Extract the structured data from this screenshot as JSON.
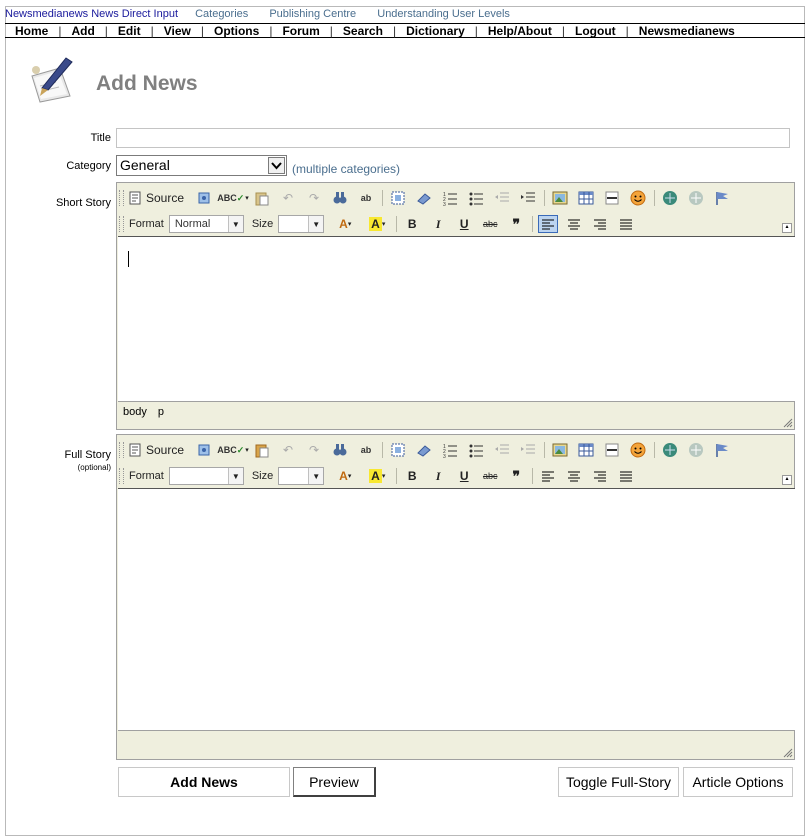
{
  "toplinks": {
    "site": "Newsmedianews News Direct Input",
    "categories": "Categories",
    "publishing": "Publishing Centre",
    "levels": "Understanding User Levels"
  },
  "menu": [
    "Home",
    "Add",
    "Edit",
    "View",
    "Options",
    "Forum",
    "Search",
    "Dictionary",
    "Help/About",
    "Logout",
    "Newsmedianews"
  ],
  "page": {
    "title": "Add News",
    "icon": "pen-paper-icon"
  },
  "form": {
    "title_label": "Title",
    "title_value": "",
    "category_label": "Category",
    "category_value": "General",
    "multiple_categories": "(multiple categories)",
    "short_story_label": "Short Story",
    "full_story_label": "Full Story",
    "full_story_optional": "(optional)"
  },
  "editor": {
    "source_label": "Source",
    "format_label": "Format",
    "format_value_short": "Normal",
    "format_value_full": "",
    "size_label": "Size",
    "size_value": "",
    "short_status_path": [
      "body",
      "p"
    ]
  },
  "buttons": {
    "add_news": "Add News",
    "preview": "Preview",
    "toggle_full_story": "Toggle Full-Story",
    "article_options": "Article Options"
  },
  "colors": {
    "toolbar_bg": "#efefde",
    "link": "#4a6e8e",
    "heading": "#808080"
  }
}
